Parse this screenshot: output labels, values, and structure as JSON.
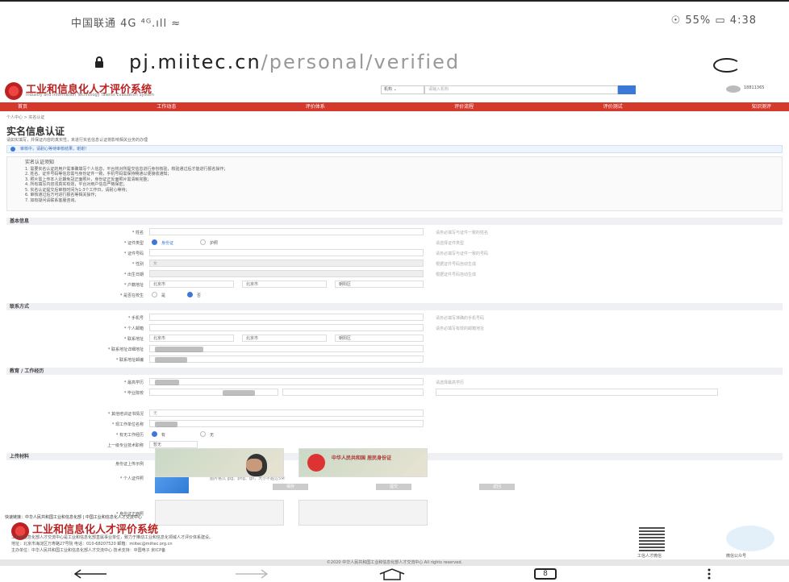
{
  "status": {
    "left": "中国联通 4G ⁴ᴳ.ıll ≈",
    "right": "☉ 55% ▭ 4:38"
  },
  "address": {
    "host": "pj.miitec.cn",
    "path": "/personal/verified"
  },
  "site": {
    "brand": "工业和信息化人才评价系统",
    "brand_en": "Industry and Information Technology Talents Evaluation System",
    "search_select": "机构 ⌄",
    "search_placeholder": "请输入机构",
    "user": "18811365",
    "nav": [
      "首页",
      "工作动态",
      "评价体系",
      "评价流程",
      "评价测试",
      "知识测评"
    ],
    "breadcrumb": "个人中心 > 实名认证",
    "title": "实名信息认证",
    "desc": "请如实填写，并保证内容的真实性，未进行实名信息认证将影响相关业务的办理",
    "notice": "审核中，请耐心等待审核结果，谢谢！",
    "rules": {
      "title": "实名认证须知",
      "lines": [
        "1. 需要实名认证的用户需准确填写个人信息，平台将对所提交信息进行身份核验，核验通过后才能进行报名操作；",
        "2. 姓名、证件号码等信息需与身份证件一致，手机号码需保持畅通以便接收通知；",
        "3. 照片需上传本人近期免冠正面照片，身份证正反面照片需清晰完整；",
        "4. 所有填写内容须真实有效，平台对用户信息严格保密；",
        "5. 实名认证提交后审核时间为1-3个工作日，请耐心等待；",
        "6. 审核通过后方可进行报名等相关操作；",
        "7. 如有疑问请联系客服咨询。"
      ]
    },
    "sections": {
      "basic": "基本信息",
      "contact": "联系方式",
      "edu": "教育 / 工作经历",
      "upload": "上传材料"
    },
    "basic": [
      {
        "label": "* 姓名",
        "value": "",
        "hint": "请务必填写与证件一致的姓名"
      },
      {
        "label": "* 证件类型",
        "value": "",
        "hint": "请选择证件类型"
      },
      {
        "label": "* 证件号码",
        "value": "",
        "hint": "请务必填写与证件一致的号码"
      },
      {
        "label": "* 性别",
        "value": "女",
        "hint": "根据证件号码自动生成"
      },
      {
        "label": "* 出生日期",
        "value": "",
        "hint": "根据证件号码自动生成"
      },
      {
        "label": "* 户籍地址",
        "value": "",
        "hint": ""
      },
      {
        "label": "* 是否在校生",
        "value": "",
        "hint": ""
      }
    ],
    "id_types": [
      "身份证",
      "护照"
    ],
    "regions": [
      "北京市",
      "北京市",
      "朝阳区"
    ],
    "student": [
      "是",
      "否"
    ],
    "contact": [
      {
        "label": "* 手机号",
        "hint": "请务必填写准确的手机号码"
      },
      {
        "label": "* 个人邮箱",
        "hint": "请务必填写有效的邮箱地址"
      },
      {
        "label": "* 联系地址",
        "hint": ""
      },
      {
        "label": "* 联系地址详细地址",
        "hint": ""
      },
      {
        "label": "* 联系地址邮编",
        "hint": ""
      }
    ],
    "edu": [
      {
        "label": "* 最高学历",
        "hint": "请选择最高学历"
      },
      {
        "label": "* 毕业院校",
        "hint": ""
      },
      {
        "label": "* 其他培训证书情况",
        "value": "无"
      },
      {
        "label": "* 现工作单位名称",
        "value": ""
      },
      {
        "label": "* 有无工作经历",
        "value": ""
      },
      {
        "label": "上一级专业技术职称",
        "value": "暂无"
      }
    ],
    "work": [
      "有",
      "无"
    ],
    "upload": {
      "photo_label": "* 个人证件照",
      "photo_hint": "图片格式 jpg、png、gif，大小不超过5M",
      "id_front_label": "* 身份证正面照",
      "id_back_label": "身份证上传示例",
      "id_text": "中华人民共和国 居民身份证"
    },
    "buttons": [
      "保存",
      "提交",
      "返回"
    ],
    "footer": {
      "links": "快速链接：中华人民共和国工业和信息化部 | 中国工业和信息化人才交流中心",
      "brand": "工业和信息化人才评价系统",
      "lines": [
        "工业和信息化部人才交流中心是工业和信息化部直属事业单位，致力于推动工业和信息化领域人才评价体系建设。",
        "地址：北京市海淀区万寿路27号院  电话：010-68207520  邮箱：miitec@miitec.org.cn",
        "主办单位：中华人民共和国工业和信息化部人才交流中心  技术支持：中国电子  京ICP备"
      ],
      "qr1": "工信人才微信",
      "qr2": "微信公众号",
      "copyright": "©2020 中华人民共和国工业和信息化部人才交流中心 All rights reserved."
    }
  },
  "navbar": {
    "tab_count": "8"
  }
}
